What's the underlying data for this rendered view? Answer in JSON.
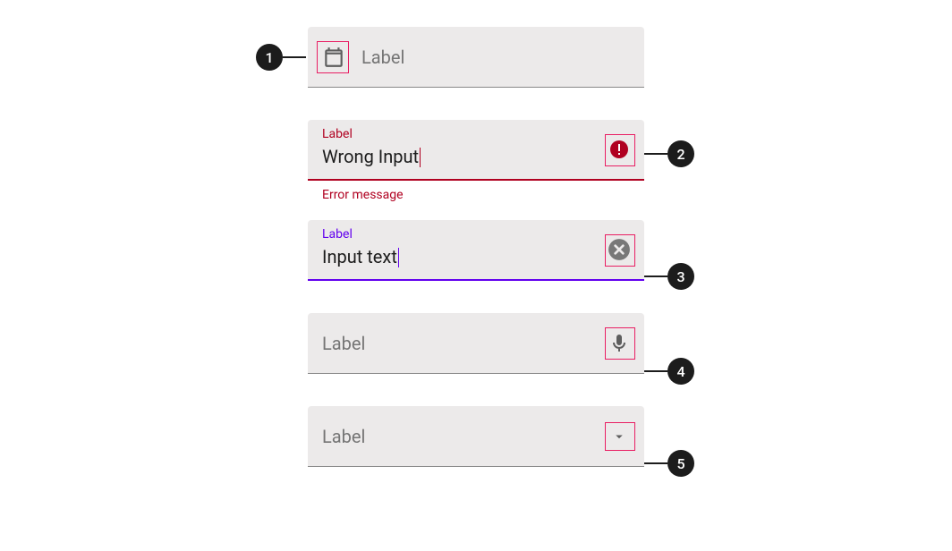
{
  "fields": {
    "f1": {
      "label": "Label"
    },
    "f2": {
      "label": "Label",
      "value": "Wrong Input",
      "error": "Error message"
    },
    "f3": {
      "label": "Label",
      "value": "Input text"
    },
    "f4": {
      "label": "Label"
    },
    "f5": {
      "label": "Label"
    }
  },
  "callouts": {
    "c1": "1",
    "c2": "2",
    "c3": "3",
    "c4": "4",
    "c5": "5"
  }
}
